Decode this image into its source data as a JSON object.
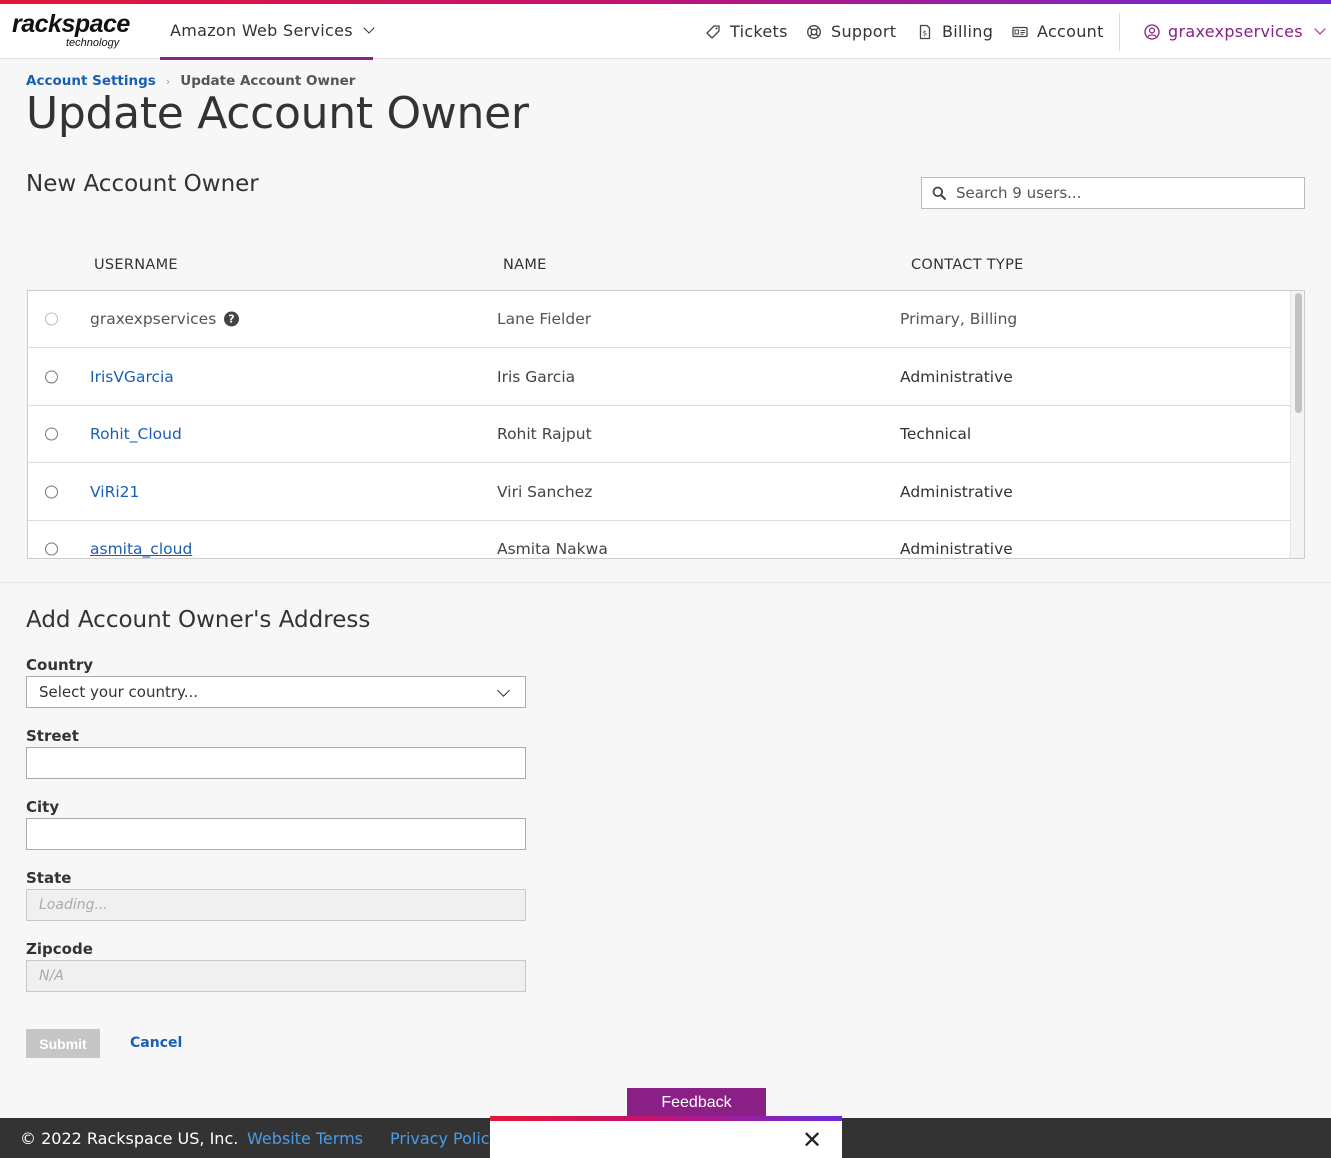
{
  "brand": {
    "logo_word": "rackspace",
    "logo_sub": "technology",
    "stripe_colors": [
      "#e31837",
      "#c4126e",
      "#6b2bd9"
    ],
    "accent": "#8a1f85",
    "link_color": "#1a5fb4"
  },
  "header": {
    "product": "Amazon Web Services",
    "nav": [
      {
        "label": "Tickets",
        "icon": "ticket-icon"
      },
      {
        "label": "Support",
        "icon": "lifebuoy-icon"
      },
      {
        "label": "Billing",
        "icon": "invoice-icon"
      },
      {
        "label": "Account",
        "icon": "id-card-icon"
      }
    ],
    "user": "graxexpservices"
  },
  "breadcrumb": {
    "parent": "Account Settings",
    "current": "Update Account Owner"
  },
  "page_title": "Update Account Owner",
  "owner_section": {
    "heading": "New Account Owner",
    "search_placeholder": "Search 9 users...",
    "columns": [
      "USERNAME",
      "NAME",
      "CONTACT TYPE"
    ],
    "rows": [
      {
        "username": "graxexpservices",
        "name": "Lane Fielder",
        "contact_type": "Primary, Billing",
        "disabled": true,
        "help": "?"
      },
      {
        "username": "IrisVGarcia",
        "name": "Iris Garcia",
        "contact_type": "Administrative",
        "disabled": false
      },
      {
        "username": "Rohit_Cloud",
        "name": "Rohit Rajput",
        "contact_type": "Technical",
        "disabled": false
      },
      {
        "username": "ViRi21",
        "name": "Viri Sanchez",
        "contact_type": "Administrative",
        "disabled": false
      },
      {
        "username": "asmita_cloud",
        "name": "Asmita Nakwa",
        "contact_type": "Administrative",
        "disabled": false
      }
    ]
  },
  "address_section": {
    "heading": "Add Account Owner's Address",
    "country": {
      "label": "Country",
      "value": "Select your country..."
    },
    "street": {
      "label": "Street",
      "value": ""
    },
    "city": {
      "label": "City",
      "value": ""
    },
    "state": {
      "label": "State",
      "placeholder": "Loading..."
    },
    "zipcode": {
      "label": "Zipcode",
      "placeholder": "N/A"
    },
    "submit_label": "Submit",
    "cancel_label": "Cancel"
  },
  "feedback_label": "Feedback",
  "footer": {
    "copyright": "© 2022 Rackspace US, Inc.",
    "links": [
      "Website Terms",
      "Privacy Policy"
    ]
  },
  "popup": {
    "close_glyph": "✕"
  }
}
